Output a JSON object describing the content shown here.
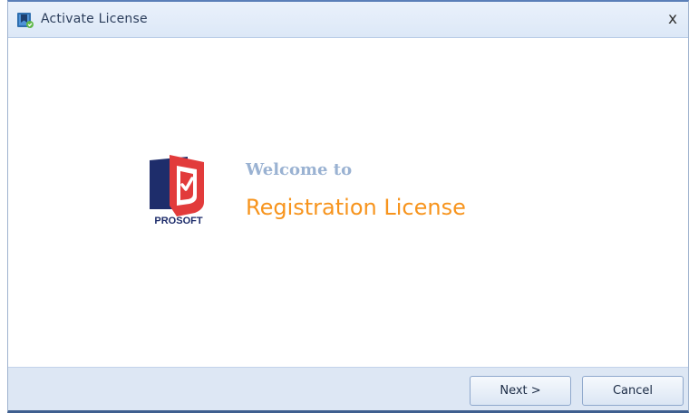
{
  "window": {
    "title": "Activate License",
    "close_glyph": "x"
  },
  "content": {
    "logo_text": "PROSOFT",
    "welcome": "Welcome to",
    "heading": "Registration License"
  },
  "footer": {
    "next_label": "Next >",
    "cancel_label": "Cancel"
  },
  "colors": {
    "accent_orange": "#f7941d",
    "welcome_blue": "#9ab2d2",
    "logo_red": "#e23b3b",
    "logo_navy": "#1e2d6b"
  },
  "icons": {
    "app": "license-app-icon",
    "close": "close-icon",
    "logo": "prosoft-logo"
  }
}
